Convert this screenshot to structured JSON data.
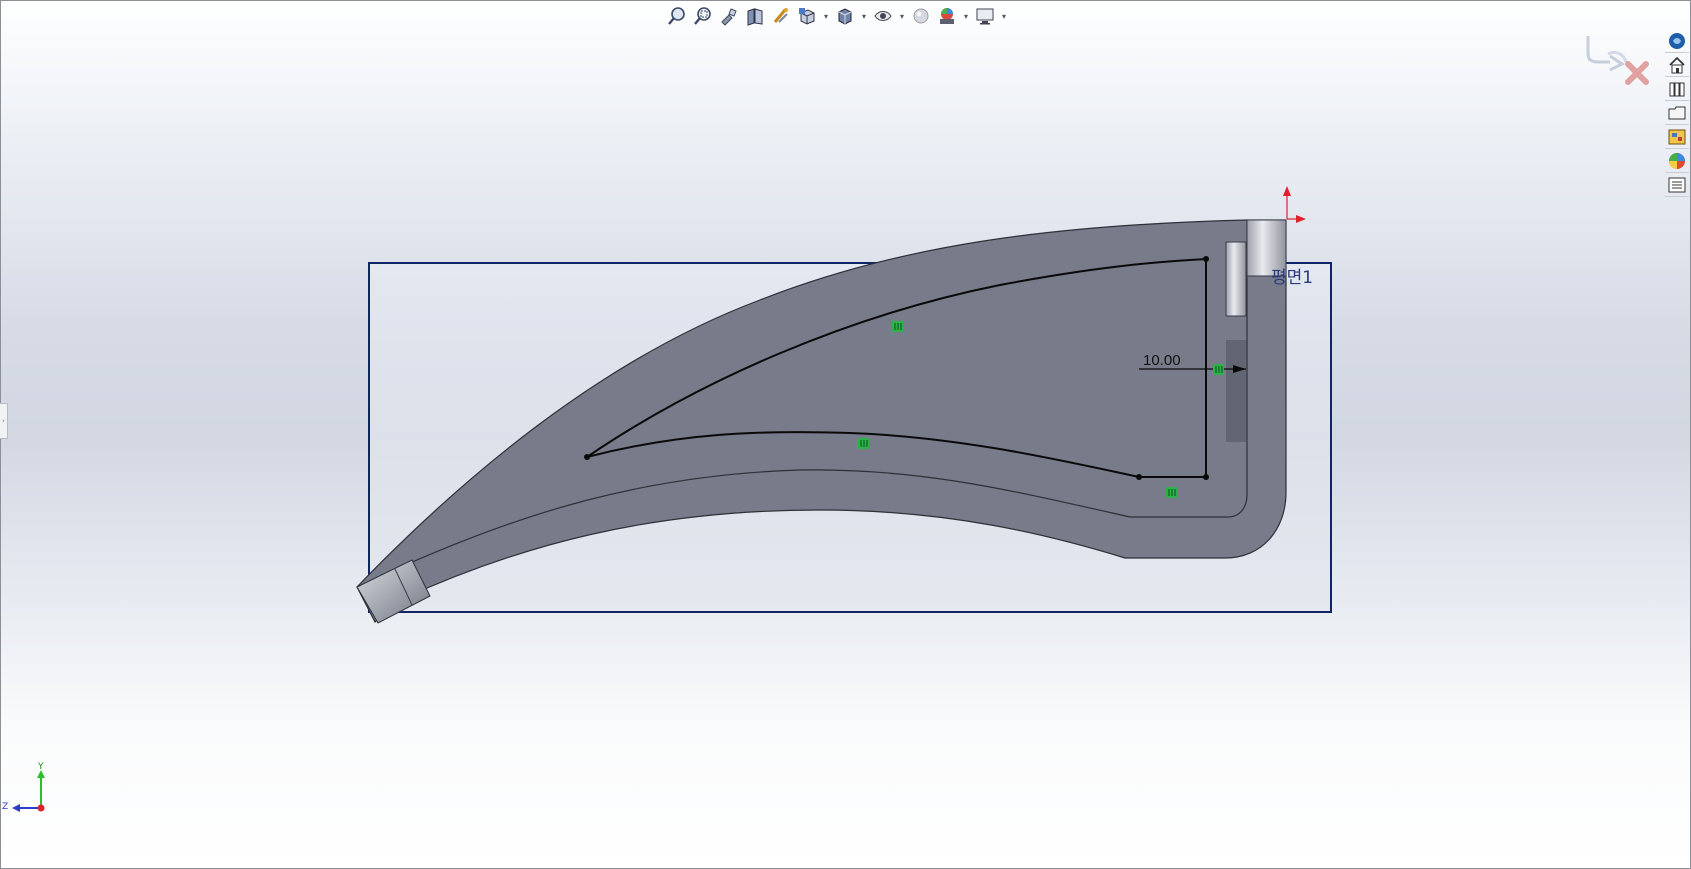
{
  "hud_toolbar": {
    "items": [
      {
        "icon": "zoom-to-fit-icon",
        "dropdown": false
      },
      {
        "icon": "zoom-to-area-icon",
        "dropdown": false
      },
      {
        "icon": "previous-view-icon",
        "dropdown": false
      },
      {
        "icon": "section-view-icon",
        "dropdown": false
      },
      {
        "icon": "dynamic-annotation-icon",
        "dropdown": false
      },
      {
        "icon": "view-orientation-icon",
        "dropdown": true
      },
      {
        "icon": "display-style-icon",
        "dropdown": true
      },
      {
        "icon": "hide-show-items-icon",
        "dropdown": true
      },
      {
        "icon": "edit-appearance-icon",
        "dropdown": false
      },
      {
        "icon": "apply-scene-icon",
        "dropdown": true
      },
      {
        "icon": "view-settings-icon",
        "dropdown": true
      }
    ]
  },
  "task_pane": {
    "items": [
      "solidworks-resources-icon",
      "home-icon",
      "design-library-icon",
      "file-explorer-icon",
      "view-palette-icon",
      "appearances-icon",
      "custom-properties-icon"
    ]
  },
  "confirmation_corner": {
    "accept_icon": "exit-sketch-icon",
    "cancel_icon": "cancel-icon"
  },
  "sketch": {
    "dimension_text": "10.00",
    "plane_label": "평면1"
  },
  "triad": {
    "y_label": "Y",
    "z_label": "Z"
  },
  "colors": {
    "part_body": "#7a7e8d",
    "part_edge": "#3a3d48",
    "plane_border": "#0f2568",
    "origin_red": "#e0202a",
    "relation_green": "#2bb34a",
    "sketch_line": "#0a0a0a"
  }
}
